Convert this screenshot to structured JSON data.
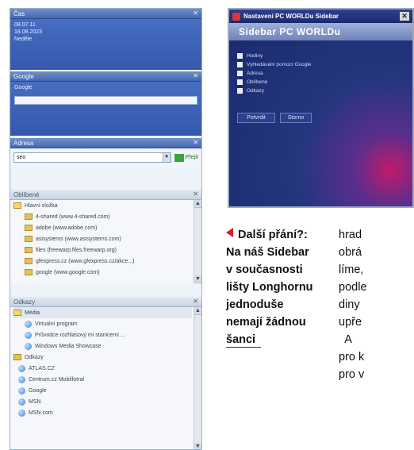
{
  "sidebar": {
    "clock_panel": {
      "lines": [
        "08.07.11",
        "18.08.2023",
        "Neděle"
      ]
    },
    "google_panel": {
      "placeholder": "Google"
    },
    "address_panel": {
      "value": "seo",
      "go_label": "Přejít"
    },
    "favorites": {
      "root": "Hlavní složka",
      "items": [
        "4-shared (www.4-shared.com)",
        "adobe (www.adobe.com)",
        "asisystems (www.asisystems.com)",
        "files (freewarp.files.freewarp.org)",
        "gfexpress.cz (www.gfexpress.cz/akce...)",
        "google (www.google.com)"
      ]
    },
    "links": {
      "media_folder": "Média",
      "media_items": [
        "Virtuální program",
        "Průvodce rozhlasový mi stanicemi ...",
        "Windows Media Showcase"
      ],
      "other_folder": "Odkazy",
      "other_items": [
        "ATLAS.CZ",
        "Centrum.cz Mobilfotral",
        "Google",
        "MSN",
        "MSN.com"
      ]
    }
  },
  "dialog": {
    "title": "Nastavení PC WORLDu Sidebar",
    "header": "Sidebar PC WORLDu",
    "options": [
      "Hodiny",
      "Vyhledávání pomocí Google",
      "Adresa",
      "Oblíbené",
      "Odkazy"
    ],
    "apply_label": "Potvrdit",
    "cancel_label": "Storno"
  },
  "caption": {
    "lines": [
      "Další přání?:",
      "Na náš Sidebar",
      "v současnosti",
      "lišty Longhornu",
      "jednoduše",
      "nemají žádnou",
      "šanci"
    ]
  },
  "article": {
    "lines": [
      "hrad",
      "obrá",
      "líme,",
      "podle",
      "diny",
      "upře",
      "  A",
      "pro k",
      "pro v"
    ]
  }
}
